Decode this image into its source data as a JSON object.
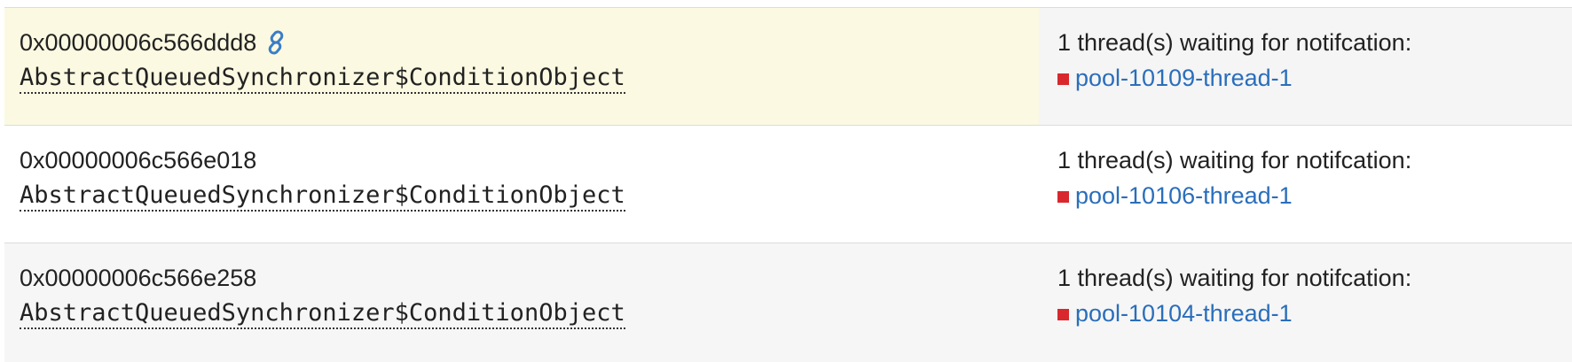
{
  "colors": {
    "thread_link": "#2a6ebb",
    "state_square": "#d8282e",
    "highlight_bg": "#fbf9e1",
    "link_icon": "#3b7dc8"
  },
  "rows": [
    {
      "address": "0x00000006c566ddd8",
      "class_name": "AbstractQueuedSynchronizer$ConditionObject",
      "has_link_icon": true,
      "link_icon": "link-chain-icon",
      "wait_label": "1 thread(s) waiting for notifcation:",
      "thread": "pool-10109-thread-1"
    },
    {
      "address": "0x00000006c566e018",
      "class_name": "AbstractQueuedSynchronizer$ConditionObject",
      "has_link_icon": false,
      "wait_label": "1 thread(s) waiting for notifcation:",
      "thread": "pool-10106-thread-1"
    },
    {
      "address": "0x00000006c566e258",
      "class_name": "AbstractQueuedSynchronizer$ConditionObject",
      "has_link_icon": false,
      "wait_label": "1 thread(s) waiting for notifcation:",
      "thread": "pool-10104-thread-1"
    }
  ]
}
